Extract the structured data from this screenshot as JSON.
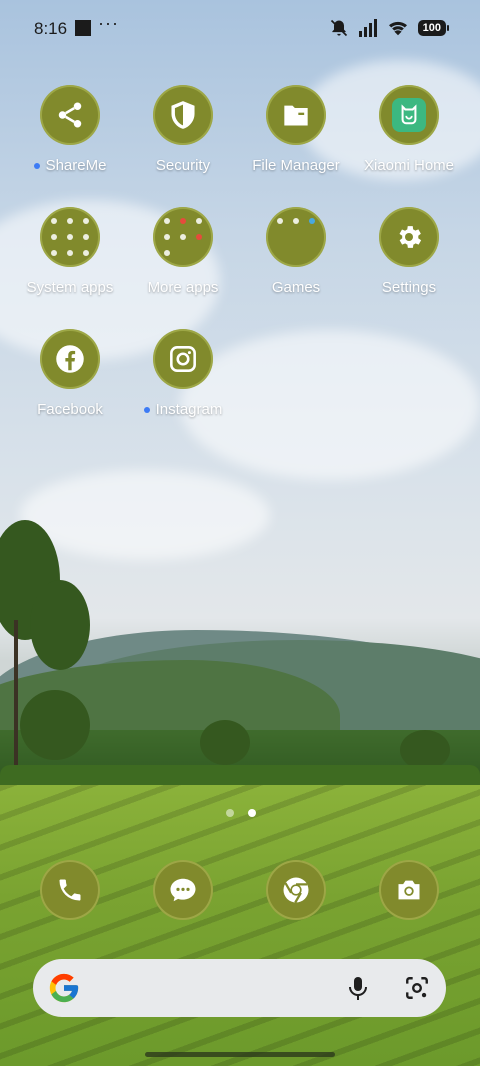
{
  "status_bar": {
    "time": "8:16",
    "more": "···",
    "battery": "100",
    "icons": [
      "notifications-off-icon",
      "signal-icon",
      "wifi-icon",
      "battery-icon"
    ]
  },
  "apps": [
    {
      "label": "ShareMe",
      "icon": "share-icon",
      "new_dot": true
    },
    {
      "label": "Security",
      "icon": "shield-icon",
      "new_dot": false
    },
    {
      "label": "File Manager",
      "icon": "folder-icon",
      "new_dot": false
    },
    {
      "label": "Xiaomi Home",
      "icon": "xiaomi-home-icon",
      "new_dot": false
    },
    {
      "label": "System apps",
      "icon": "folder-grid-icon",
      "new_dot": false
    },
    {
      "label": "More apps",
      "icon": "folder-grid-icon",
      "new_dot": false
    },
    {
      "label": "Games",
      "icon": "folder-grid-icon",
      "new_dot": false
    },
    {
      "label": "Settings",
      "icon": "gear-icon",
      "new_dot": false
    },
    {
      "label": "Facebook",
      "icon": "facebook-icon",
      "new_dot": false
    },
    {
      "label": "Instagram",
      "icon": "instagram-icon",
      "new_dot": true
    }
  ],
  "page_indicator": {
    "pages": 2,
    "current": 2
  },
  "dock": [
    {
      "icon": "phone-icon"
    },
    {
      "icon": "messages-icon"
    },
    {
      "icon": "chrome-icon"
    },
    {
      "icon": "camera-icon"
    }
  ],
  "search": {
    "icons": [
      "google-logo-icon",
      "mic-icon",
      "google-lens-icon"
    ]
  },
  "colors": {
    "icon_bg": "#818a2c",
    "new_dot": "#3d7bf5",
    "xiaomi_home": "#3cb881"
  }
}
